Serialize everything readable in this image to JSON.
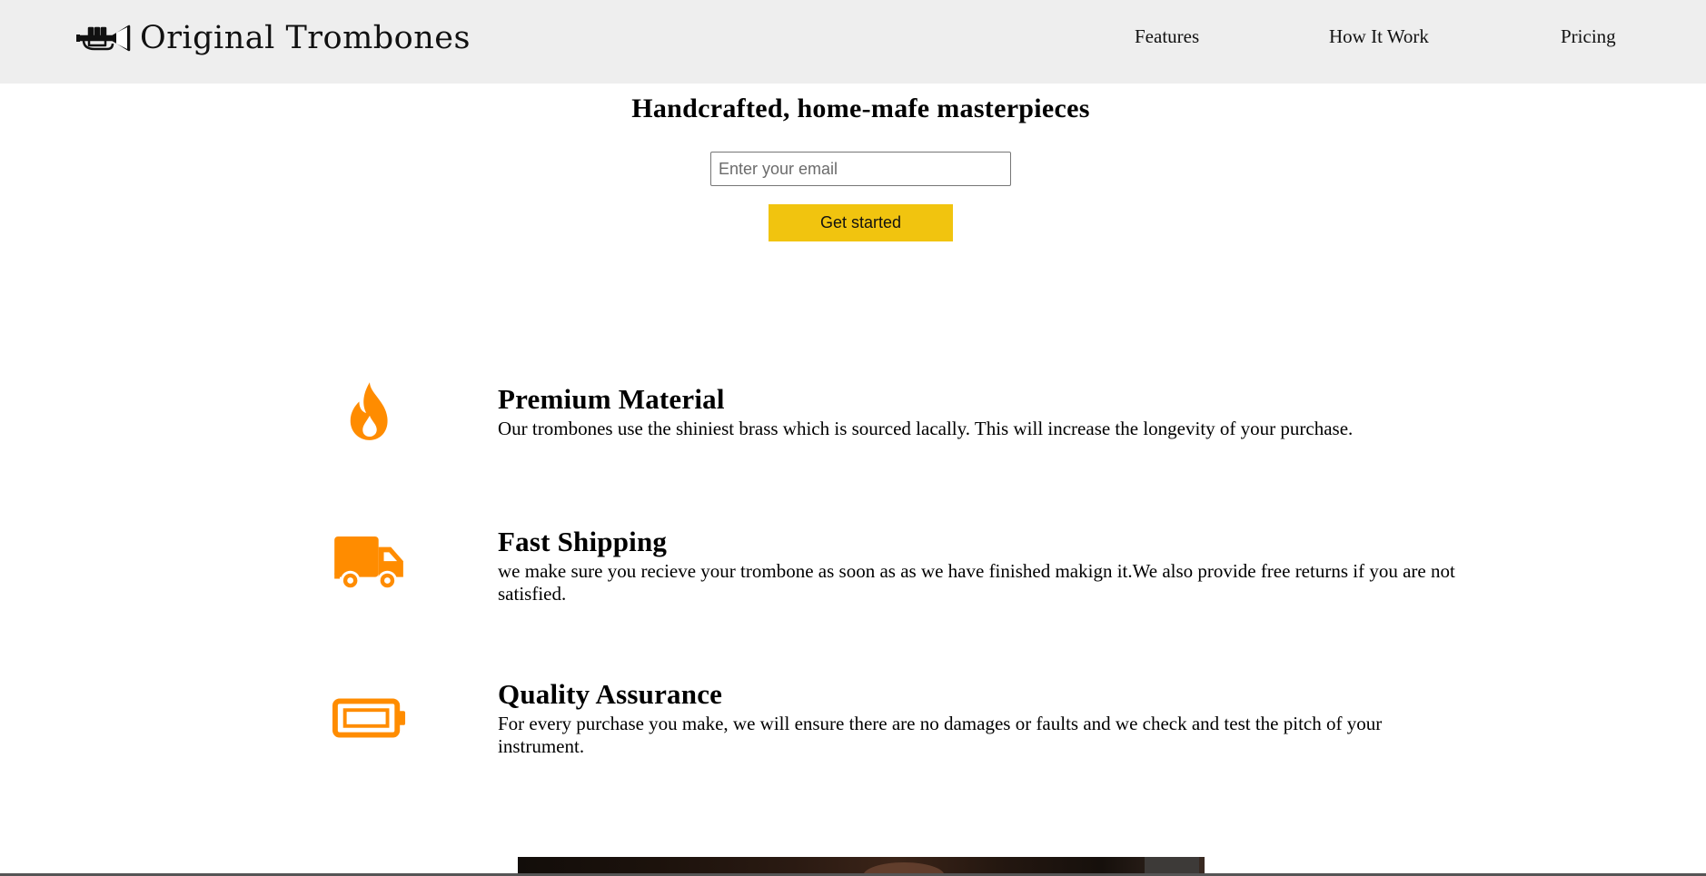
{
  "brand": {
    "name": "Original Trombones",
    "icon": "trumpet-icon"
  },
  "nav": {
    "items": [
      {
        "label": "Features"
      },
      {
        "label": "How It Work"
      },
      {
        "label": "Pricing"
      }
    ]
  },
  "hero": {
    "title": "Handcrafted, home-mafe masterpieces",
    "email_placeholder": "Enter your email",
    "button_label": "Get started"
  },
  "features": [
    {
      "icon": "fire-icon",
      "title": "Premium Material",
      "description": "Our trombones use the shiniest brass which is sourced lacally. This will increase the longevity of your purchase."
    },
    {
      "icon": "truck-icon",
      "title": "Fast Shipping",
      "description": "we make sure you recieve your trombone as soon as as we have finished makign it.We also provide free returns if you are not satisfied."
    },
    {
      "icon": "battery-icon",
      "title": "Quality Assurance",
      "description": "For every purchase you make, we will ensure there are no damages or faults and we check and test the pitch of your instrument."
    }
  ],
  "colors": {
    "header_bg": "#eeeeee",
    "accent": "#f1c40f",
    "icon_orange": "#ff8c00"
  }
}
